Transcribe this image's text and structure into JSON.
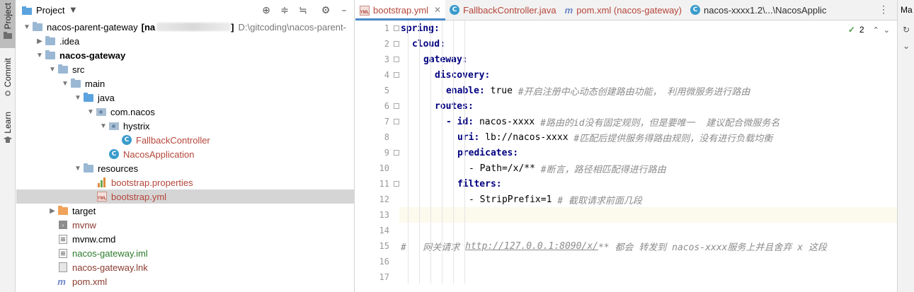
{
  "left_strip": {
    "tabs": [
      "Project",
      "Commit",
      "Learn"
    ]
  },
  "project_panel": {
    "title": "Project",
    "tree": [
      {
        "label": "nacos-parent-gateway",
        "bracket": "[na",
        "bracket_end": "]",
        "path": "D:\\gitcoding\\nacos-parent-",
        "icon": "folder-icon",
        "arrow": "down",
        "bold": false
      },
      {
        "label": ".idea",
        "icon": "folder-icon",
        "arrow": "right"
      },
      {
        "label": "nacos-gateway",
        "icon": "folder-module-icon",
        "arrow": "down",
        "bold": true
      },
      {
        "label": "src",
        "icon": "folder-icon",
        "arrow": "down"
      },
      {
        "label": "main",
        "icon": "folder-icon",
        "arrow": "down"
      },
      {
        "label": "java",
        "icon": "folder-source-icon",
        "arrow": "down"
      },
      {
        "label": "com.nacos",
        "icon": "package-icon",
        "arrow": "down"
      },
      {
        "label": "hystrix",
        "icon": "package-icon",
        "arrow": "down"
      },
      {
        "label": "FallbackController",
        "icon": "class-icon",
        "color": "red"
      },
      {
        "label": "NacosApplication",
        "icon": "class-icon",
        "color": "red"
      },
      {
        "label": "resources",
        "icon": "resources-folder-icon",
        "arrow": "down"
      },
      {
        "label": "bootstrap.properties",
        "icon": "properties-file-icon",
        "color": "red"
      },
      {
        "label": "bootstrap.yml",
        "icon": "yml-file-icon",
        "color": "red",
        "selected": true
      },
      {
        "label": "target",
        "icon": "folder-excluded-icon",
        "arrow": "right"
      },
      {
        "label": "mvnw",
        "icon": "terminal-file-icon",
        "color": "purple"
      },
      {
        "label": "mvnw.cmd",
        "icon": "file-icon"
      },
      {
        "label": "nacos-gateway.iml",
        "icon": "iml-file-icon",
        "color": "green"
      },
      {
        "label": "nacos-gateway.lnk",
        "icon": "file-icon",
        "color": "purple"
      },
      {
        "label": "pom.xml",
        "icon": "maven-icon",
        "color": "purple"
      }
    ]
  },
  "editor": {
    "tabs": [
      {
        "label": "bootstrap.yml",
        "icon": "yml-file-icon",
        "active": true,
        "color": "red"
      },
      {
        "label": "FallbackController.java",
        "icon": "class-icon",
        "color": "red"
      },
      {
        "label": "pom.xml (nacos-gateway)",
        "icon": "maven-icon",
        "color": "red"
      },
      {
        "label": "nacos-xxxx1.2\\...\\NacosApplic",
        "icon": "class-icon",
        "color": "dark"
      }
    ],
    "inspection_count": "2",
    "current_line": 13,
    "lines": [
      {
        "n": "1",
        "indent": 0,
        "key": "spring:",
        "value": "",
        "comment": ""
      },
      {
        "n": "2",
        "indent": 1,
        "key": "cloud:",
        "value": "",
        "comment": ""
      },
      {
        "n": "3",
        "indent": 2,
        "key": "gateway:",
        "value": "",
        "comment": ""
      },
      {
        "n": "4",
        "indent": 3,
        "key": "discovery:",
        "value": "",
        "comment": ""
      },
      {
        "n": "5",
        "indent": 4,
        "key": "enable:",
        "value": " true ",
        "comment": "#开启注册中心动态创建路由功能， 利用微服务进行路由"
      },
      {
        "n": "6",
        "indent": 3,
        "key": "routes:",
        "value": "",
        "comment": ""
      },
      {
        "n": "7",
        "indent": 4,
        "key": "- id:",
        "value": " nacos-xxxx ",
        "comment": "#路由的id没有固定规则，但是要唯一  建议配合微服务名"
      },
      {
        "n": "8",
        "indent": 5,
        "key": "uri:",
        "value": " lb://nacos-xxxx ",
        "comment": "#匹配后提供服务得路由规则，没有进行负载均衡"
      },
      {
        "n": "9",
        "indent": 5,
        "key": "predicates:",
        "value": "",
        "comment": ""
      },
      {
        "n": "10",
        "indent": 6,
        "key": "",
        "value": "- Path=/x/** ",
        "comment": "#断言，路径相匹配得进行路由"
      },
      {
        "n": "11",
        "indent": 5,
        "key": "filters:",
        "value": "",
        "comment": ""
      },
      {
        "n": "12",
        "indent": 6,
        "key": "",
        "value": "- StripPrefix=1 ",
        "comment": "# 截取请求前面几段"
      },
      {
        "n": "13",
        "indent": 0,
        "key": "",
        "value": "",
        "comment": ""
      },
      {
        "n": "14",
        "indent": 0,
        "key": "",
        "value": "",
        "comment": ""
      },
      {
        "n": "15",
        "indent": 0,
        "key": "",
        "value": "",
        "comment": "#   网关请求 ",
        "url": "http://127.0.0.1:8090/x/",
        "comment_tail": "** 都会 转发到 nacos-xxxx服务上并且舍弃 x 这段"
      },
      {
        "n": "16",
        "indent": 0,
        "key": "",
        "value": "",
        "comment": ""
      },
      {
        "n": "17",
        "indent": 0,
        "key": "",
        "value": "",
        "comment": ""
      }
    ]
  },
  "right_strip": {
    "label": "Ma"
  }
}
